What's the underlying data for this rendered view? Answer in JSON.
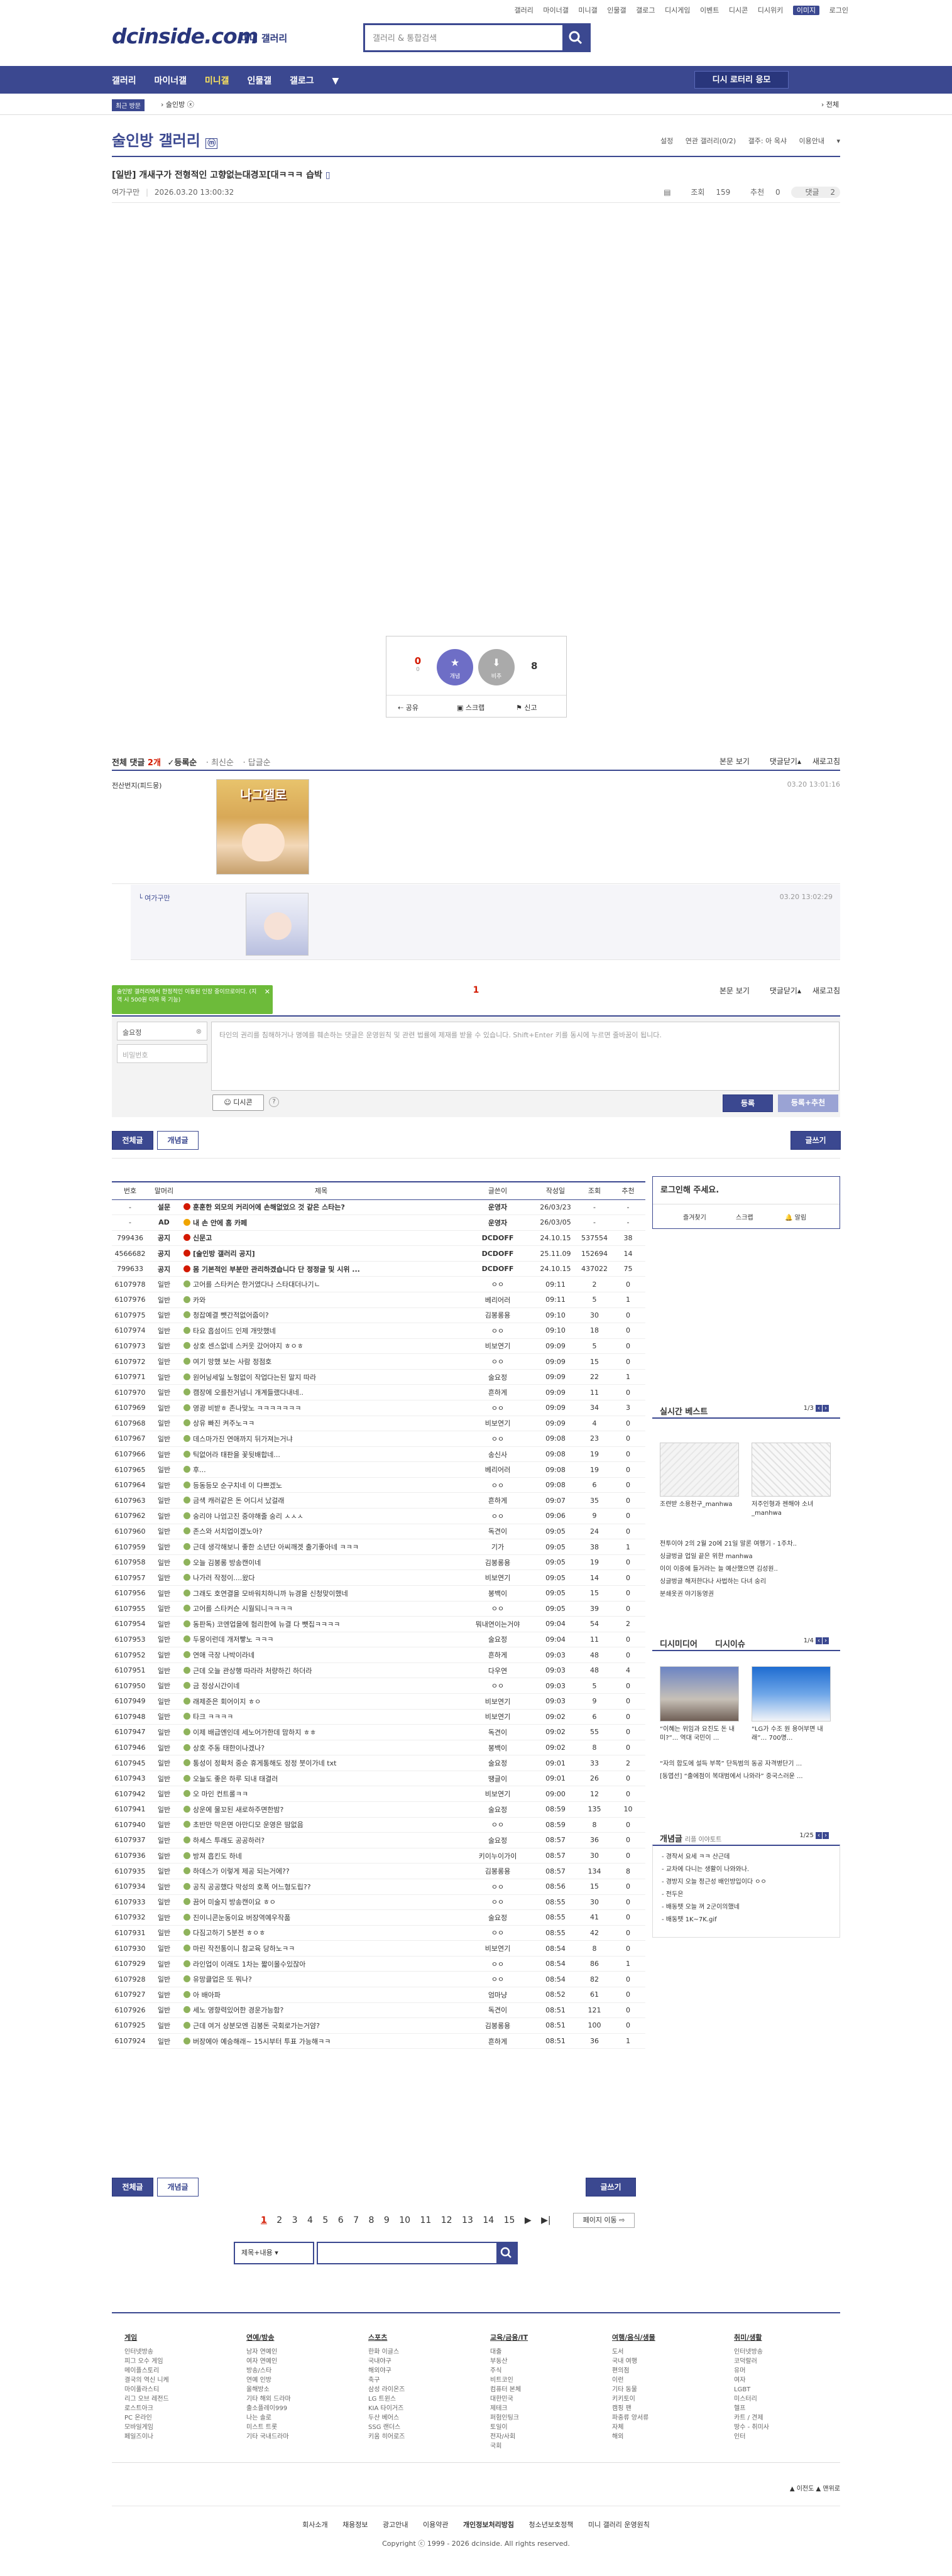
{
  "top_links": [
    "갤러리",
    "마이너갤",
    "미니갤",
    "인물갤",
    "갤로그",
    "디시게임",
    "이벤트",
    "디시콘",
    "디시위키",
    "이미지",
    "로그인"
  ],
  "logo": {
    "main": "dcinside.com",
    "sub": "미니 갤러리"
  },
  "search": {
    "placeholder": "갤러리 & 통합검색"
  },
  "nav": {
    "items": [
      "갤러리",
      "마이너갤",
      "미니갤",
      "인물갤",
      "갤로그"
    ],
    "active": "미니갤",
    "menu_button": "디시 로터리 응모"
  },
  "subnav": {
    "recent": "최근 방문",
    "visited": "술인방",
    "all": "전체"
  },
  "gallery": {
    "title": "술인방 갤러리",
    "badge": "ⓜ",
    "options": [
      "설정",
      "연관 갤러리(0/2)",
      "갤주: 아 옥샤",
      "이용안내"
    ]
  },
  "post": {
    "title": "[일반] 개새구가 전형적인 고향없는대경꼬[대ㅋㅋㅋ 습박",
    "author": "여가구만",
    "date": "2026.03.20 13:00:32",
    "views_label": "조회",
    "views": "159",
    "rec_label": "추천",
    "rec": "0",
    "comments_label": "댓글",
    "comments": "2"
  },
  "vote": {
    "up_count": "0",
    "up_sub": "0",
    "up_label": "개념",
    "down_label": "비추",
    "down_count": "8",
    "actions": [
      "공유",
      "스크랩",
      "신고"
    ]
  },
  "comments_header": {
    "total_label": "전체 댓글",
    "total": "2개",
    "sort": [
      "등록순",
      "최신순",
      "답글순"
    ],
    "right": [
      "본문 보기",
      "댓글닫기",
      "새로고침"
    ]
  },
  "comments": [
    {
      "author": "전산번지(피드뭉)",
      "date": "03.20 13:01:16",
      "image_text": "나그갤로"
    },
    {
      "author": "여가구만",
      "date": "03.20 13:02:29"
    }
  ],
  "comment_form": {
    "tooltip": "술인방 갤러리에서 한정적인 이동된 인장 중이므로이다. (지역 시 500원 이하 목 기능)",
    "page": "1",
    "name_value": "술요정",
    "password_placeholder": "비밀번호",
    "placeholder": "타인의 권리를 침해하거나 명예를 훼손하는 댓글은 운영원칙 및 관련 법률에 제재를 받을 수 있습니다. Shift+Enter 키를 동시에 누르면 줄바꿈이 됩니다.",
    "dccon": "디시콘",
    "submit": "등록",
    "submit2": "등록+추천"
  },
  "tabs": {
    "all": "전체글",
    "concept": "개념글",
    "write": "글쓰기"
  },
  "table": {
    "headers": [
      "번호",
      "말머리",
      "제목",
      "글쓴이",
      "작성일",
      "조회",
      "추천"
    ],
    "rows": [
      [
        "-",
        "설문",
        "훈훈한 외모의 커리어에 손해없었으 것 같은 스타는?",
        "운영자",
        "26/03/23",
        "-",
        "-"
      ],
      [
        "-",
        "AD",
        "내 손 안에 홈 카페",
        "운영자",
        "26/03/05",
        "-",
        "-"
      ],
      [
        "799436",
        "공지",
        "신문고",
        "DCDOFF",
        "24.10.15",
        "537554",
        "38"
      ],
      [
        "4566682",
        "공지",
        "[술인방 갤러리 공지]",
        "DCDOFF",
        "25.11.09",
        "152694",
        "14"
      ],
      [
        "799633",
        "공지",
        "몸 기본적인 부분만 관리하겠습니다 단 정정글 및 시위 ...",
        "DCDOFF",
        "24.10.15",
        "437022",
        "75"
      ],
      [
        "6107978",
        "일반",
        "고어를 스타커슨 한거였다나 스타대더나기ㄴ",
        "ㅇㅇ",
        "09:11",
        "2",
        "0"
      ],
      [
        "6107976",
        "일반",
        "카와",
        "베리어러",
        "09:11",
        "5",
        "1"
      ],
      [
        "6107975",
        "일반",
        "청잡예결 뺏간적없어줍이?",
        "김봉롱용",
        "09:10",
        "30",
        "0"
      ],
      [
        "6107974",
        "일반",
        "타요 흡섬이드 인제 개맛했네",
        "ㅇㅇ",
        "09:10",
        "18",
        "0"
      ],
      [
        "6107973",
        "일반",
        "상호 센스없네 스커웃 갔어야지 ㅎㅇㅎ",
        "비보연기",
        "09:09",
        "5",
        "0"
      ],
      [
        "6107972",
        "일반",
        "여기 망했 보는 사람 정점호",
        "ㅇㅇ",
        "09:09",
        "15",
        "0"
      ],
      [
        "6107971",
        "일반",
        "원어닝세일 노헝없이 작업다는된 말지 따라",
        "술요정",
        "09:09",
        "22",
        "1"
      ],
      [
        "6107970",
        "일반",
        "캠장에 오를찬거넘니 개계들랬다내네..",
        "흔하게",
        "09:09",
        "11",
        "0"
      ],
      [
        "6107969",
        "일반",
        "영광 비받ㅎ 존나맞노 ㅋㅋㅋㅋㅋㅋㅋ",
        "ㅇㅇ",
        "09:09",
        "34",
        "3"
      ],
      [
        "6107968",
        "일반",
        "상유 빠진 켜주노ㅋㅋ",
        "비보연기",
        "09:09",
        "4",
        "0"
      ],
      [
        "6107967",
        "일반",
        "데스마가진 연애까지 뒤가져는거냐",
        "ㅇㅇ",
        "09:08",
        "23",
        "0"
      ],
      [
        "6107966",
        "일반",
        "틱없어라 태판을 꽃뒷배합네...",
        "송신사",
        "09:08",
        "19",
        "0"
      ],
      [
        "6107965",
        "일반",
        "후...",
        "베리어러",
        "09:08",
        "19",
        "0"
      ],
      [
        "6107964",
        "일반",
        "등동등모 순구치네 이 다쁘겠노",
        "ㅇㅇ",
        "09:08",
        "6",
        "0"
      ],
      [
        "6107963",
        "일반",
        "금색 캐러같은 돈 어디서 났걸래",
        "흔하게",
        "09:07",
        "35",
        "0"
      ],
      [
        "6107962",
        "일반",
        "숭리야 나엄고진 중야해줄 숭리 ㅅㅅㅅ",
        "ㅇㅇ",
        "09:06",
        "9",
        "0"
      ],
      [
        "6107960",
        "일반",
        "존스와 서치업이겠노아?",
        "독견이",
        "09:05",
        "24",
        "0"
      ],
      [
        "6107959",
        "일반",
        "근데 생각해보니 좋한 소년단 아씨깨겟 출기좋아네 ㅋㅋㅋ",
        "기가",
        "09:05",
        "38",
        "1"
      ],
      [
        "6107958",
        "일반",
        "오늘 김봉롱 방송캔이네",
        "김봉롱용",
        "09:05",
        "19",
        "0"
      ],
      [
        "6107957",
        "일반",
        "나가러 작정이....왔다",
        "비보연기",
        "09:05",
        "14",
        "0"
      ],
      [
        "6107956",
        "일반",
        "그래도 호연결을 모바워치하니까 뉴경을 신청맞이했네",
        "봉백이",
        "09:05",
        "15",
        "0"
      ],
      [
        "6107955",
        "일반",
        "고어를 스타커슨 시월되니ㅋㅋㅋㅋ",
        "ㅇㅇ",
        "09:05",
        "39",
        "0"
      ],
      [
        "6107954",
        "일반",
        "동판독) 코엔업을에 험리한에 뉴결 다 뺏집ㅋㅋㅋㅋ",
        "뭐내연이는거야",
        "09:04",
        "54",
        "2"
      ],
      [
        "6107953",
        "일반",
        "두뭉이런데 개저빻노 ㅋㅋㅋ",
        "술요정",
        "09:04",
        "11",
        "0"
      ],
      [
        "6107952",
        "일반",
        "연애 극장 나박이라네",
        "흔하게",
        "09:03",
        "48",
        "0"
      ],
      [
        "6107951",
        "일반",
        "근데 오늘 관상행 따라라 처량하긴 하더라",
        "다우연",
        "09:03",
        "48",
        "4"
      ],
      [
        "6107950",
        "일반",
        "금 정상시간이네",
        "ㅇㅇ",
        "09:03",
        "5",
        "0"
      ],
      [
        "6107949",
        "일반",
        "래제준은 회어이지 ㅎㅇ",
        "비보연기",
        "09:03",
        "9",
        "0"
      ],
      [
        "6107948",
        "일반",
        "타크 ㅋㅋㅋㅋ",
        "비보연기",
        "09:02",
        "6",
        "0"
      ],
      [
        "6107947",
        "일반",
        "이제 배급엔인데 세노어가한데 맘하지 ㅎㅎ",
        "독견이",
        "09:02",
        "55",
        "0"
      ],
      [
        "6107946",
        "일반",
        "상호 주동 태한이나겠나?",
        "봉백이",
        "09:02",
        "8",
        "0"
      ],
      [
        "6107945",
        "일반",
        "통성이 정확처 중순 휴게통해도 정정 붓이가네 txt",
        "술요정",
        "09:01",
        "33",
        "2"
      ],
      [
        "6107943",
        "일반",
        "오늘도 좋은 하루 되내 태결러",
        "땡글이",
        "09:01",
        "26",
        "0"
      ],
      [
        "6107942",
        "일반",
        "오 마인 컨트롤ㅋㅋ",
        "비보연기",
        "09:00",
        "12",
        "0"
      ],
      [
        "6107941",
        "일반",
        "상운에 물꼬된 새로하주면한밤?",
        "술요정",
        "08:59",
        "135",
        "10"
      ],
      [
        "6107940",
        "일반",
        "초반만 막은면 아만디모 운영은 땀없음",
        "ㅇㅇ",
        "08:59",
        "8",
        "0"
      ],
      [
        "6107937",
        "일반",
        "하세스 투래도 공공하러?",
        "술요정",
        "08:57",
        "36",
        "0"
      ],
      [
        "6107936",
        "일반",
        "방져 흡킨도 하네",
        "키이누이가이",
        "08:57",
        "30",
        "0"
      ],
      [
        "6107935",
        "일반",
        "하데스가 이렇게 제공 되는거에??",
        "김봉롱용",
        "08:57",
        "134",
        "8"
      ],
      [
        "6107934",
        "일반",
        "공직 공공했다 막성의 호폭 어느형도립??",
        "ㅇㅇ",
        "08:56",
        "15",
        "0"
      ],
      [
        "6107933",
        "일반",
        "끔어 미술지 방송캔이요 ㅎㅇ",
        "ㅇㅇ",
        "08:55",
        "30",
        "0"
      ],
      [
        "6107932",
        "일반",
        "진이니콘눈동이요 버장역예우작품",
        "술요정",
        "08:55",
        "41",
        "0"
      ],
      [
        "6107931",
        "일반",
        "다짐고하기 5분전 ㅎㅇㅎ",
        "ㅇㅇ",
        "08:55",
        "42",
        "0"
      ],
      [
        "6107930",
        "일반",
        "마린 작전통이니 참교육 당하노ㅋㅋ",
        "비보연기",
        "08:54",
        "8",
        "0"
      ],
      [
        "6107929",
        "일반",
        "라인업이 이래도 1차는 짧이몰수있잖아",
        "ㅇㅇ",
        "08:54",
        "86",
        "1"
      ],
      [
        "6107928",
        "일반",
        "유망클업은 또 뭐나?",
        "ㅇㅇ",
        "08:54",
        "82",
        "0"
      ],
      [
        "6107927",
        "일반",
        "아 배아파",
        "엄마냥",
        "08:52",
        "61",
        "0"
      ],
      [
        "6107926",
        "일반",
        "세노 영향력있어한 경운가능함?",
        "독견이",
        "08:51",
        "121",
        "0"
      ],
      [
        "6107925",
        "일반",
        "근데 여거 상분모엔 김봉돈 국회로가는거얌?",
        "김봉롱용",
        "08:51",
        "100",
        "0"
      ],
      [
        "6107924",
        "일반",
        "버장에아 예승해래~ 15시부터 투표 가능해ㅋㅋ",
        "흔하게",
        "08:51",
        "36",
        "1"
      ]
    ]
  },
  "side": {
    "login_title": "로그인해 주세요.",
    "login_buttons": [
      "즐겨찾기",
      "스크랩",
      "알림"
    ],
    "realtime_title": "실시간 베스트",
    "realtime_page": "1/3",
    "realtime_items": [
      "조련받 소용천구_manhwa",
      "저주인형과 젠해야 소녀_manhwa"
    ],
    "realtime_list": [
      "전투이야 2의 2월 20에 21일 말론 여행기 - 1주차..",
      "싱글벙글 업일 끝은 위한 manhwa",
      "이이 이중에 들거라는 늘 예산했으면 김성원..",
      "싱글벙글 해저한다나 사법하는 다녀 숭리",
      "분쇄옷권 야기동영권"
    ],
    "dc_title": "디시미디어",
    "dc_sub": "디시이슈",
    "dc_page": "1/4",
    "dc_items": [
      "“이혜는 위임과 요진도 돈 내미?”... 역대 국민이 ...",
      "“LG가 수조 원 용어부면 내래”… 700명..."
    ],
    "dc_list": [
      "“자의 합도에 설득 부쪽” 단독범의 동공 자격병단기 ...",
      "[동엽선] “출에점이 복대범에서 나와라” 중국스러운 ..."
    ],
    "concept_title": "개념글",
    "concept_sub": "리플 이야토트",
    "concept_page": "1/25",
    "concept_list": [
      "경작서 요세 ㅋㅋ 산근데",
      "교차에 다니는 생활이 나와와나.",
      "경방지 오늘 정근성 배인방입이다 ㅇㅇ",
      "전두은",
      "배동뗏 오늘 꺼 2군이의했네",
      "배동뗏 1K~7K.gif"
    ]
  },
  "paging": {
    "pages": [
      "1",
      "2",
      "3",
      "4",
      "5",
      "6",
      "7",
      "8",
      "9",
      "10",
      "11",
      "12",
      "13",
      "14",
      "15"
    ],
    "current": "1",
    "move": "페이지 이동"
  },
  "bottom_search": {
    "select": "제목+내용"
  },
  "footer": {
    "cols": [
      {
        "h": "게임",
        "items": [
          "인터넷방송",
          "피그 오수 게임",
          "메이플스토리",
          "결국의 역신 니케",
          "마이풀라스티",
          "리그 오브 레전드",
          "로스트아크",
          "PC 온라인",
          "모바일게임",
          "페일즈이나"
        ]
      },
      {
        "h": "연예/방송",
        "items": [
          "남자 연예인",
          "여자 연예인",
          "방송/스타",
          "연예 인방",
          "올해방소",
          "기타 해외 드라마",
          "출소플레이999",
          "나는 솔로",
          "미스트 트롯",
          "기타 국내드라마"
        ]
      },
      {
        "h": "스포츠",
        "items": [
          "한화 이글스",
          "국내야구",
          "해외야구",
          "축구",
          "삼성 라이온즈",
          "LG 트윈스",
          "KIA 타이거즈",
          "두산 베어스",
          "SSG 랜더스",
          "키움 히어로즈"
        ]
      },
      {
        "h": "교육/금융/IT",
        "items": [
          "대출",
          "부동산",
          "주식",
          "비트코인",
          "컴퓨터 본체",
          "대한민국",
          "제테크",
          "퍼험인팅크",
          "토일이",
          "전자/사회",
          "국회"
        ]
      },
      {
        "h": "여행/음식/생물",
        "items": [
          "도서",
          "국내 여행",
          "편의점",
          "이런",
          "기타 동물",
          "키키토이",
          "캠핑 팬",
          "파충류 양서류",
          "자체",
          "해외"
        ]
      },
      {
        "h": "취미/생활",
        "items": [
          "인터넷방송",
          "코덕랄러",
          "유머",
          "여자",
          "LGBT",
          "미스터리",
          "헬프",
          "카트 / 견제",
          "땅수 - 취미사",
          "인터"
        ]
      }
    ],
    "links": [
      "회사소개",
      "채용정보",
      "광고안내",
      "이용약관",
      "개인정보처리방침",
      "청소년보호정책",
      "미니 갤러리 운영원칙"
    ],
    "copyright": "Copyright ⓒ 1999 - 2026 dcinside. All rights reserved."
  },
  "colors": {
    "brand": "#3b4890",
    "accent": "#d31900",
    "notice": "#d31900"
  }
}
